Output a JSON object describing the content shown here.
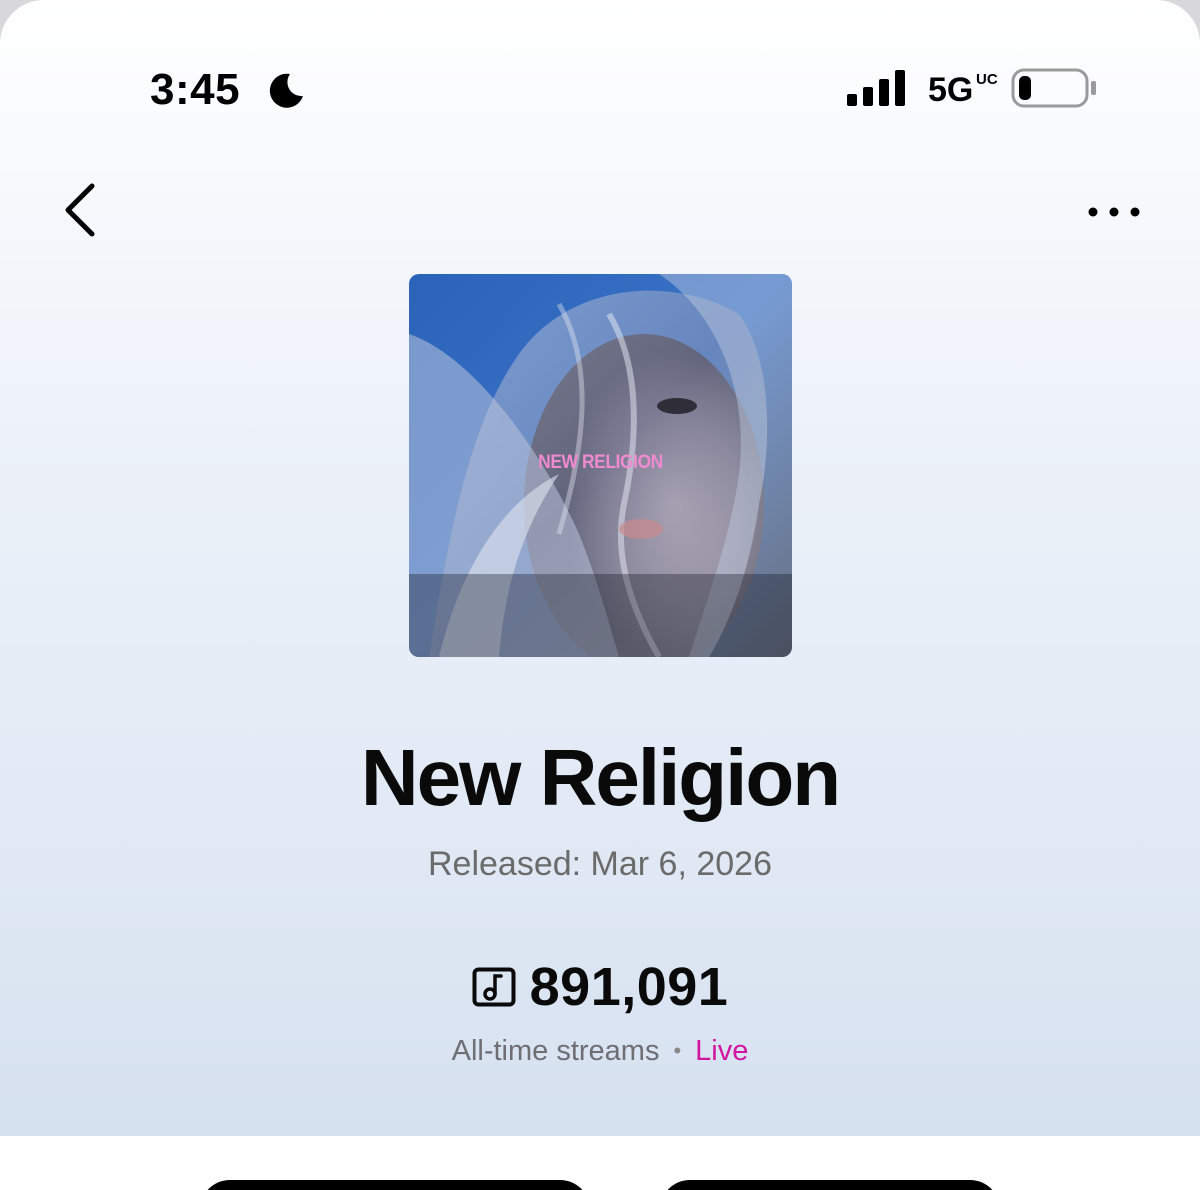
{
  "status_bar": {
    "time": "3:45",
    "network": "5G",
    "network_sub": "UC",
    "icons": [
      "moon-icon",
      "signal-icon",
      "battery-icon"
    ]
  },
  "nav": {
    "back_icon": "chevron-left-icon",
    "more_icon": "ellipsis-icon"
  },
  "cover": {
    "text": "NEW RELIGION",
    "accent_color": "#f08ad0"
  },
  "track": {
    "title": "New Religion",
    "released": "Released: Mar 6, 2026"
  },
  "stats": {
    "icon": "music-note-icon",
    "streams": "891,091",
    "label": "All-time streams",
    "separator": "•",
    "live": "Live",
    "live_color": "#d3169f"
  }
}
